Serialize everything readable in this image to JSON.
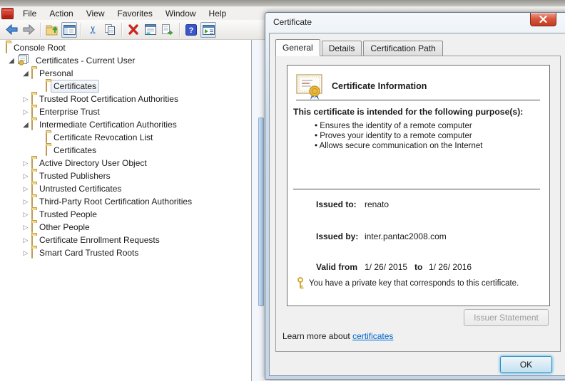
{
  "window": {
    "menu": [
      "File",
      "Action",
      "View",
      "Favorites",
      "Window",
      "Help"
    ],
    "toolbar_icons": [
      "back",
      "forward",
      "sep",
      "up-folder",
      "show-console-tree",
      "sep",
      "cut",
      "copy",
      "sep",
      "delete",
      "properties",
      "export-list",
      "sep",
      "help",
      "show-action-pane"
    ]
  },
  "tree": {
    "items": [
      {
        "label": "Console Root",
        "level": 0,
        "expander": "none",
        "icon": "folder",
        "selected": false
      },
      {
        "label": "Certificates - Current User",
        "level": 1,
        "expander": "expanded",
        "icon": "certmgr",
        "selected": false
      },
      {
        "label": "Personal",
        "level": 2,
        "expander": "expanded",
        "icon": "folder",
        "selected": false
      },
      {
        "label": "Certificates",
        "level": 3,
        "expander": "none",
        "icon": "folder",
        "selected": true
      },
      {
        "label": "Trusted Root Certification Authorities",
        "level": 2,
        "expander": "collapsed",
        "icon": "folder",
        "selected": false
      },
      {
        "label": "Enterprise Trust",
        "level": 2,
        "expander": "collapsed",
        "icon": "folder",
        "selected": false
      },
      {
        "label": "Intermediate Certification Authorities",
        "level": 2,
        "expander": "expanded",
        "icon": "folder",
        "selected": false
      },
      {
        "label": "Certificate Revocation List",
        "level": 3,
        "expander": "none",
        "icon": "folder",
        "selected": false
      },
      {
        "label": "Certificates",
        "level": 3,
        "expander": "none",
        "icon": "folder",
        "selected": false
      },
      {
        "label": "Active Directory User Object",
        "level": 2,
        "expander": "collapsed",
        "icon": "folder",
        "selected": false
      },
      {
        "label": "Trusted Publishers",
        "level": 2,
        "expander": "collapsed",
        "icon": "folder",
        "selected": false
      },
      {
        "label": "Untrusted Certificates",
        "level": 2,
        "expander": "collapsed",
        "icon": "folder",
        "selected": false
      },
      {
        "label": "Third-Party Root Certification Authorities",
        "level": 2,
        "expander": "collapsed",
        "icon": "folder",
        "selected": false
      },
      {
        "label": "Trusted People",
        "level": 2,
        "expander": "collapsed",
        "icon": "folder",
        "selected": false
      },
      {
        "label": "Other People",
        "level": 2,
        "expander": "collapsed",
        "icon": "folder",
        "selected": false
      },
      {
        "label": "Certificate Enrollment Requests",
        "level": 2,
        "expander": "collapsed",
        "icon": "folder",
        "selected": false
      },
      {
        "label": "Smart Card Trusted Roots",
        "level": 2,
        "expander": "collapsed",
        "icon": "folder",
        "selected": false
      }
    ]
  },
  "dialog": {
    "title": "Certificate",
    "tabs": [
      {
        "label": "General",
        "active": true
      },
      {
        "label": "Details",
        "active": false
      },
      {
        "label": "Certification Path",
        "active": false
      }
    ],
    "general": {
      "heading": "Certificate Information",
      "purpose_intro": "This certificate is intended for the following purpose(s):",
      "purposes": [
        "Ensures the identity of a remote computer",
        "Proves your identity to a remote computer",
        "Allows secure communication on the Internet"
      ],
      "issued_to_label": "Issued to:",
      "issued_to": "renato",
      "issued_by_label": "Issued by:",
      "issued_by": "inter.pantac2008.com",
      "valid_label": "Valid from",
      "valid_from": "1/ 26/ 2015",
      "valid_to_word": "to",
      "valid_to": "1/ 26/ 2016",
      "private_key_note": "You have a private key that corresponds to this certificate.",
      "issuer_statement_button": "Issuer Statement",
      "learn_more_prefix": "Learn more about",
      "learn_more_link": "certificates"
    },
    "ok_button": "OK"
  },
  "colors": {
    "accent_blue": "#2d8bbd",
    "link_blue": "#0066cc",
    "close_red": "#c03a21",
    "folder_yellow": "#eec768",
    "selection_border": "#b0bcc7"
  }
}
